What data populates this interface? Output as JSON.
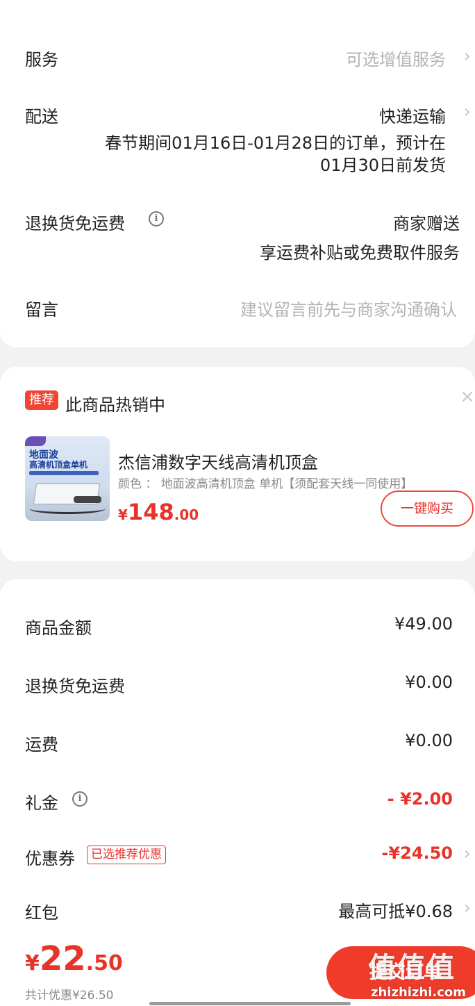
{
  "order_options": {
    "service": {
      "label": "服务",
      "value": "可选增值服务"
    },
    "delivery": {
      "label": "配送",
      "value": "快递运输",
      "note_line1": "春节期间01月16日-01月28日的订单，预计在",
      "note_line2": "01月30日前发货"
    },
    "return_shipping": {
      "label": "退换货免运费",
      "value": "商家赠送",
      "note": "享运费补贴或免费取件服务"
    },
    "message": {
      "label": "留言",
      "placeholder": "建议留言前先与商家沟通确认"
    }
  },
  "recommend": {
    "badge": "推荐",
    "title": "此商品热销中",
    "close": "×",
    "product": {
      "name": "杰信浦数字天线高清机顶盒",
      "spec": "颜色 ：  地面波高清机顶盒  单机【须配套天线一同使用】",
      "thumb_line1": "地面波",
      "thumb_line2": "高清机顶盒单机",
      "price_symbol": "¥",
      "price_int": "148",
      "price_dec": ".00",
      "buy_label": "一键购买"
    }
  },
  "summary": {
    "goods_amount": {
      "label": "商品金额",
      "value": "¥49.00"
    },
    "return_fee": {
      "label": "退换货免运费",
      "value": "¥0.00"
    },
    "shipping": {
      "label": "运费",
      "value": "¥0.00"
    },
    "gift": {
      "label": "礼金",
      "value": "- ¥2.00"
    },
    "coupon": {
      "label": "优惠券",
      "tag": "已选推荐优惠",
      "value": "-¥24.50"
    },
    "red_packet": {
      "label": "红包",
      "value": "最高可抵¥0.68"
    }
  },
  "footer": {
    "currency": "¥",
    "total_int": "22",
    "total_dec": ".50",
    "discount_text": "共计优惠¥26.50",
    "submit_label": "提交订单"
  },
  "watermark": {
    "text": "值值值",
    "site": "zhizhizhi.com"
  },
  "icons": {
    "chevron": "›",
    "info": "i"
  },
  "colors": {
    "accent": "#e8332a",
    "muted": "#b4b4b4"
  }
}
